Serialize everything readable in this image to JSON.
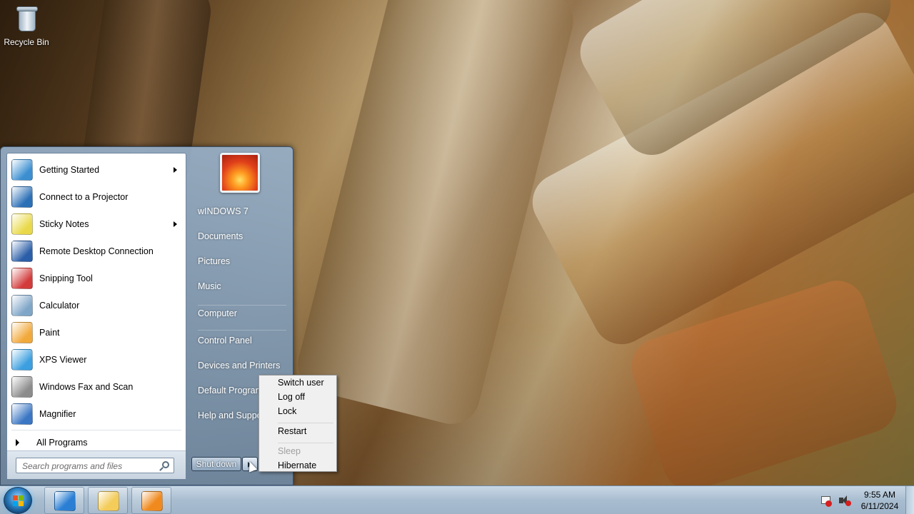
{
  "desktop": {
    "icons": [
      {
        "label": "Recycle Bin",
        "icon": "recycle-bin-icon"
      }
    ]
  },
  "start_menu": {
    "programs": [
      {
        "label": "Getting Started",
        "icon": "getting-started-icon",
        "submenu": true,
        "color": "#3b8fd1"
      },
      {
        "label": "Connect to a Projector",
        "icon": "projector-icon",
        "submenu": false,
        "color": "#2b6fb6"
      },
      {
        "label": "Sticky Notes",
        "icon": "sticky-notes-icon",
        "submenu": true,
        "color": "#e9d94a"
      },
      {
        "label": "Remote Desktop Connection",
        "icon": "remote-desktop-icon",
        "submenu": false,
        "color": "#2a5ea8"
      },
      {
        "label": "Snipping Tool",
        "icon": "snipping-tool-icon",
        "submenu": false,
        "color": "#d33b3b"
      },
      {
        "label": "Calculator",
        "icon": "calculator-icon",
        "submenu": false,
        "color": "#7fa6c7"
      },
      {
        "label": "Paint",
        "icon": "paint-icon",
        "submenu": false,
        "color": "#f2a93b"
      },
      {
        "label": "XPS Viewer",
        "icon": "xps-viewer-icon",
        "submenu": false,
        "color": "#3b9fe0"
      },
      {
        "label": "Windows Fax and Scan",
        "icon": "fax-scan-icon",
        "submenu": false,
        "color": "#8c8c8c"
      },
      {
        "label": "Magnifier",
        "icon": "magnifier-icon",
        "submenu": false,
        "color": "#3a76c4"
      }
    ],
    "all_programs_label": "All Programs",
    "search_placeholder": "Search programs and files",
    "places": [
      {
        "label": "wINDOWS 7",
        "name": "user-folder"
      },
      {
        "label": "Documents",
        "name": "documents"
      },
      {
        "label": "Pictures",
        "name": "pictures"
      },
      {
        "label": "Music",
        "name": "music"
      },
      {
        "label": "Computer",
        "name": "computer"
      },
      {
        "label": "Control Panel",
        "name": "control-panel"
      },
      {
        "label": "Devices and Printers",
        "name": "devices-and-printers"
      },
      {
        "label": "Default Programs",
        "name": "default-programs"
      },
      {
        "label": "Help and Support",
        "name": "help-and-support"
      }
    ],
    "shutdown_label": "Shut down"
  },
  "shutdown_menu": {
    "items": [
      {
        "label": "Switch user",
        "enabled": true
      },
      {
        "label": "Log off",
        "enabled": true
      },
      {
        "label": "Lock",
        "enabled": true
      },
      {
        "label": "Restart",
        "enabled": true
      },
      {
        "label": "Sleep",
        "enabled": false
      },
      {
        "label": "Hibernate",
        "enabled": true
      }
    ]
  },
  "taskbar": {
    "pinned": [
      {
        "name": "internet-explorer",
        "icon": "internet-explorer-icon",
        "color": "#2a7fd4"
      },
      {
        "name": "windows-explorer",
        "icon": "folder-icon",
        "color": "#f3cc5a"
      },
      {
        "name": "media-player",
        "icon": "media-player-icon",
        "color": "#f08a1e"
      }
    ],
    "clock": {
      "time": "9:55 AM",
      "date": "6/11/2024"
    }
  }
}
